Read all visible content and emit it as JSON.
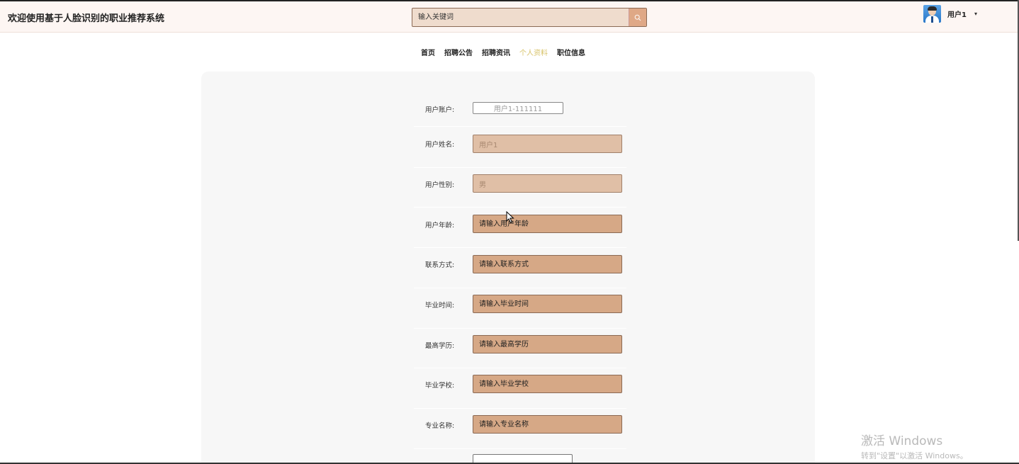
{
  "header": {
    "site_title": "欢迎使用基于人脸识别的职业推荐系统",
    "search_placeholder": "输入关键词",
    "username": "用户1",
    "caret": "▾"
  },
  "nav": {
    "items": [
      {
        "label": "首页",
        "active": false
      },
      {
        "label": "招聘公告",
        "active": false
      },
      {
        "label": "招聘资讯",
        "active": false
      },
      {
        "label": "个人资料",
        "active": true
      },
      {
        "label": "职位信息",
        "active": false
      }
    ]
  },
  "form": {
    "account": {
      "label": "用户账户:",
      "value": "用户1-111111"
    },
    "name": {
      "label": "用户姓名:",
      "value": "用户1"
    },
    "gender": {
      "label": "用户性别:",
      "value": "男"
    },
    "age": {
      "label": "用户年龄:",
      "placeholder": "请输入用户年龄"
    },
    "contact": {
      "label": "联系方式:",
      "placeholder": "请输入联系方式"
    },
    "grad_time": {
      "label": "毕业时间:",
      "placeholder": "请输入毕业时间"
    },
    "education": {
      "label": "最高学历:",
      "placeholder": "请输入最高学历"
    },
    "school": {
      "label": "毕业学校:",
      "placeholder": "请输入毕业学校"
    },
    "major": {
      "label": "专业名称:",
      "placeholder": "请输入专业名称"
    }
  },
  "watermark": {
    "title": "激活 Windows",
    "subtitle": "转到\"设置\"以激活 Windows。"
  },
  "colors": {
    "accent": "#d6a886",
    "nav_active": "#d8c36a",
    "panel_bg": "#f7f7f7"
  }
}
